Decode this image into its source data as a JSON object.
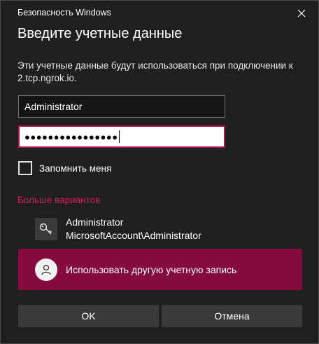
{
  "window": {
    "title": "Безопасность Windows"
  },
  "dialog": {
    "heading": "Введите учетные данные",
    "description": "Эти учетные данные будут использоваться при подключении к 2.tcp.ngrok.io."
  },
  "fields": {
    "username_value": "Administrator",
    "password_mask": "●●●●●●●●●●●●●●●●"
  },
  "remember": {
    "label": "Запомнить меня",
    "checked": false
  },
  "more_options": {
    "label": "Больше вариантов"
  },
  "account_option": {
    "name": "Administrator",
    "account": "MicrosoftAccount\\Administrator",
    "icon": "key-icon"
  },
  "other_account": {
    "label": "Использовать другую учетную запись",
    "icon": "user-icon"
  },
  "buttons": {
    "ok": "OK",
    "cancel": "Отмена"
  },
  "colors": {
    "background": "#1f1f1f",
    "accent": "#850a3d",
    "link": "#e0195a",
    "focus_border": "#b3154f",
    "button": "#3a3a3a"
  }
}
